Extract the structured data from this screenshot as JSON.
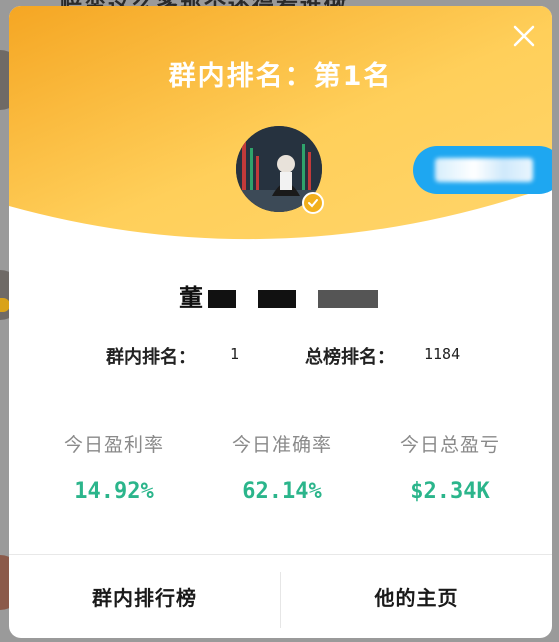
{
  "background": {
    "title": "赔蛮这么多那个还得看谁做"
  },
  "modal": {
    "title": "群内排名：第1名",
    "username": "董",
    "rank_label": "群内排名：",
    "rank_value": "1",
    "total_rank_label": "总榜排名：",
    "total_rank_value": "1184",
    "stats": [
      {
        "label": "今日盈利率",
        "value": "14.92%"
      },
      {
        "label": "今日准确率",
        "value": "62.14%"
      },
      {
        "label": "今日总盈亏",
        "value": "$2.34K"
      }
    ],
    "footer": {
      "left": "群内排行榜",
      "right": "他的主页"
    }
  },
  "colors": {
    "header_gradient_top": "#f5a623",
    "header_gradient_bottom": "#ffd56b",
    "stat_value": "#2bb58b",
    "follow_pill": "#1ea7f1",
    "verified_badge": "#f2b01c"
  },
  "icons": {
    "close": "close-icon",
    "verified": "verified-icon"
  }
}
